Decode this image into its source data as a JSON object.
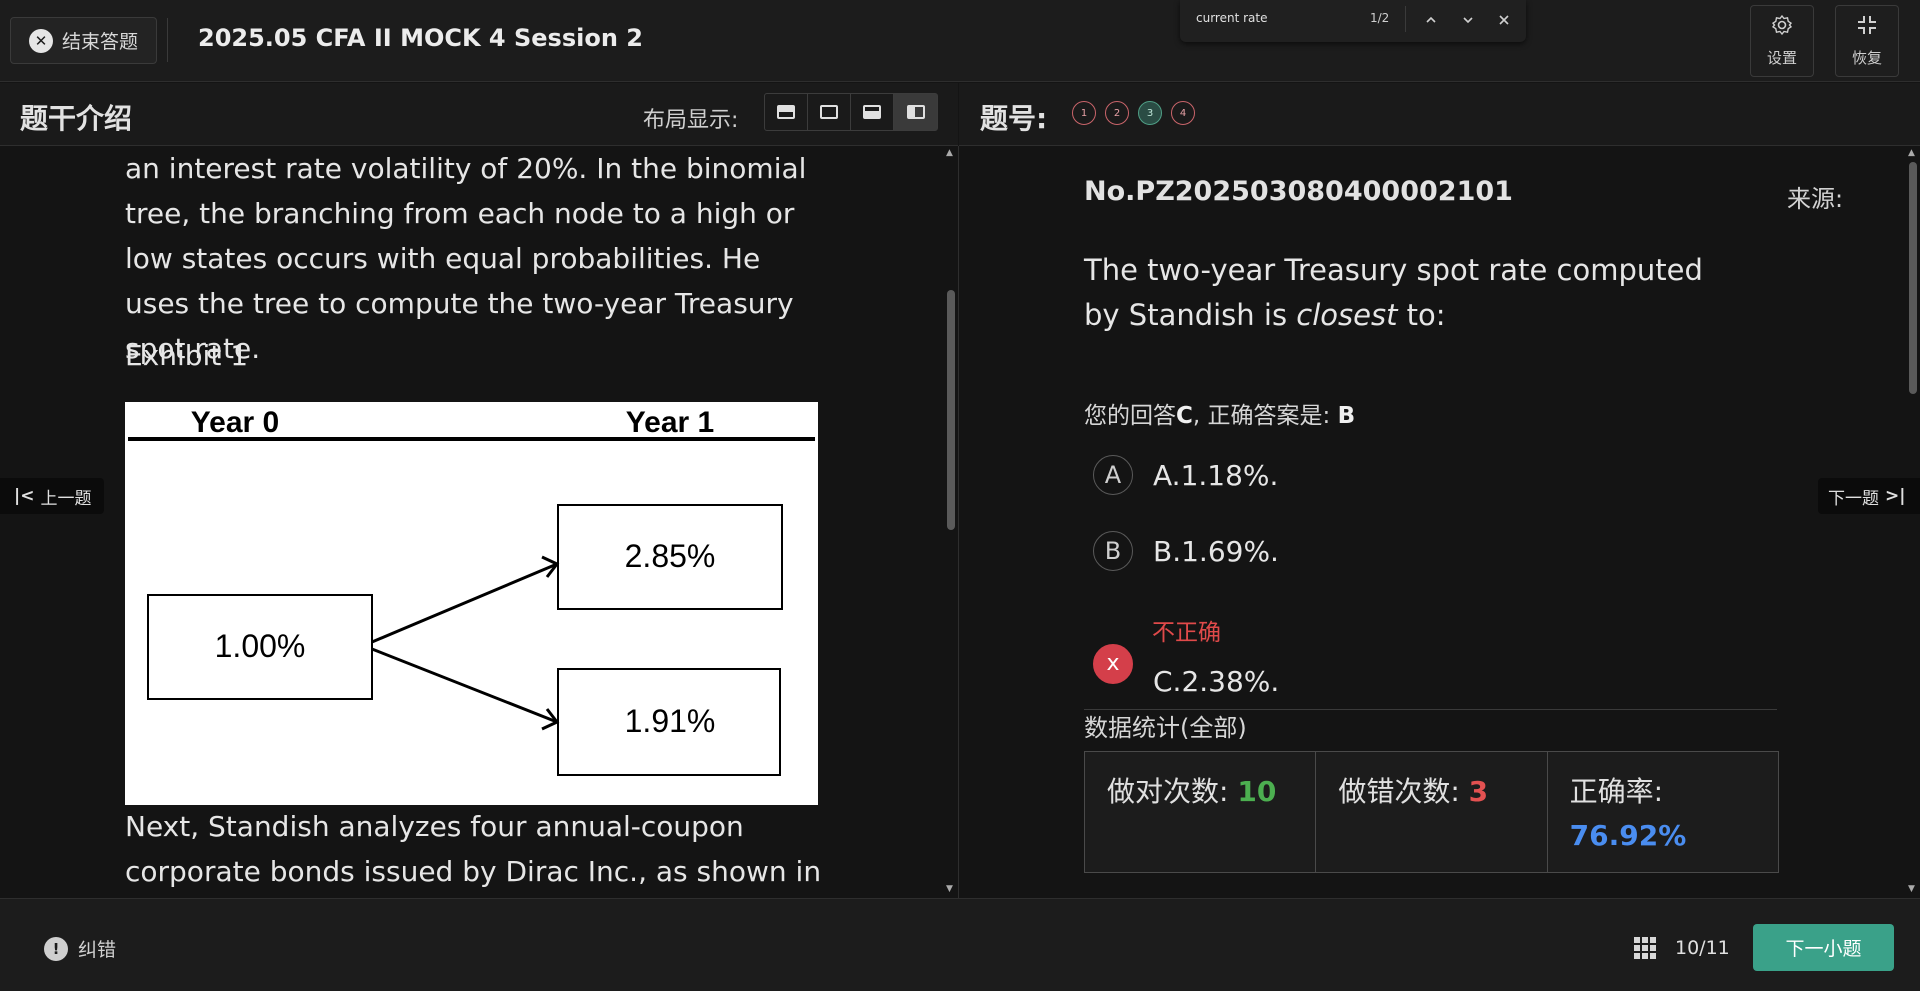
{
  "header": {
    "end_label": "结束答题",
    "exam_title": "2025.05 CFA II MOCK 4 Session 2",
    "settings_label": "设置",
    "restore_label": "恢复"
  },
  "find": {
    "query": "current rate",
    "count": "1/2"
  },
  "left": {
    "heading": "题干介绍",
    "layout_label": "布局显示:",
    "passage_top": "an interest rate volatility of 20%. In the binomial tree, the branching from each node to a high or low states occurs with equal probabilities. He uses the tree to compute the two-year Treasury spot rate.",
    "exhibit_label": "Exhibit 1",
    "tree": {
      "year0": "Year 0",
      "year1": "Year 1",
      "root": "1.00%",
      "up": "2.85%",
      "down": "1.91%"
    },
    "passage_bottom": "Next, Standish analyzes four annual-coupon corporate bonds issued by Dirac Inc., as shown in"
  },
  "right": {
    "heading": "题号:",
    "question_numbers": [
      "1",
      "2",
      "3",
      "4"
    ],
    "question_id": "No.PZ202503080400002101",
    "source_label": "来源:",
    "stem_pre": "The two-year Treasury spot rate computed by Standish is ",
    "stem_em": "closest",
    "stem_post": " to:",
    "answer_prefix": "您的回答",
    "your_answer": "C",
    "answer_mid": ", 正确答案是: ",
    "correct_answer": "B",
    "options": [
      {
        "letter": "A",
        "text": "A.1.18%."
      },
      {
        "letter": "B",
        "text": "B.1.69%."
      },
      {
        "letter": "x",
        "text": "C.2.38%."
      }
    ],
    "wrong_label": "不正确",
    "stats_title": "数据统计(全部)",
    "correct_count_label": "做对次数: ",
    "correct_count": "10",
    "wrong_count_label": "做错次数: ",
    "wrong_count": "3",
    "accuracy_label": "正确率:",
    "accuracy": "76.92%"
  },
  "nav": {
    "prev": "上一题",
    "next": "下一题"
  },
  "footer": {
    "report_label": "纠错",
    "progress": "10/11",
    "next_sub": "下一小题"
  }
}
